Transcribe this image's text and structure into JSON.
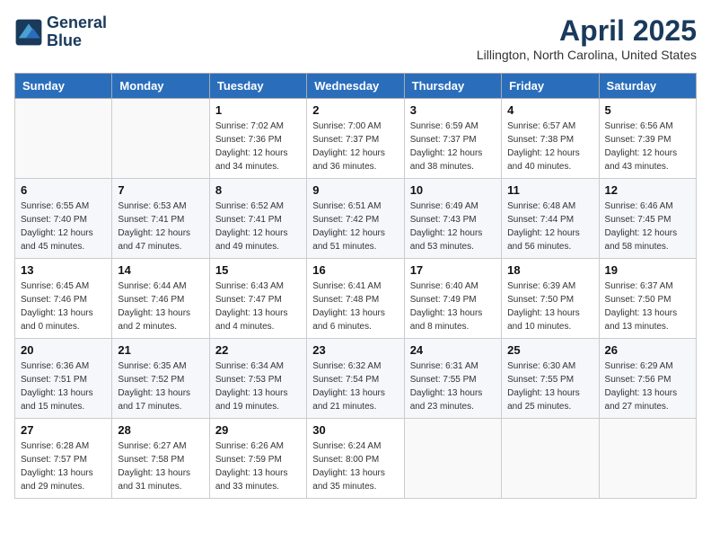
{
  "header": {
    "logo_line1": "General",
    "logo_line2": "Blue",
    "month": "April 2025",
    "location": "Lillington, North Carolina, United States"
  },
  "weekdays": [
    "Sunday",
    "Monday",
    "Tuesday",
    "Wednesday",
    "Thursday",
    "Friday",
    "Saturday"
  ],
  "weeks": [
    [
      {
        "day": "",
        "info": ""
      },
      {
        "day": "",
        "info": ""
      },
      {
        "day": "1",
        "info": "Sunrise: 7:02 AM\nSunset: 7:36 PM\nDaylight: 12 hours\nand 34 minutes."
      },
      {
        "day": "2",
        "info": "Sunrise: 7:00 AM\nSunset: 7:37 PM\nDaylight: 12 hours\nand 36 minutes."
      },
      {
        "day": "3",
        "info": "Sunrise: 6:59 AM\nSunset: 7:37 PM\nDaylight: 12 hours\nand 38 minutes."
      },
      {
        "day": "4",
        "info": "Sunrise: 6:57 AM\nSunset: 7:38 PM\nDaylight: 12 hours\nand 40 minutes."
      },
      {
        "day": "5",
        "info": "Sunrise: 6:56 AM\nSunset: 7:39 PM\nDaylight: 12 hours\nand 43 minutes."
      }
    ],
    [
      {
        "day": "6",
        "info": "Sunrise: 6:55 AM\nSunset: 7:40 PM\nDaylight: 12 hours\nand 45 minutes."
      },
      {
        "day": "7",
        "info": "Sunrise: 6:53 AM\nSunset: 7:41 PM\nDaylight: 12 hours\nand 47 minutes."
      },
      {
        "day": "8",
        "info": "Sunrise: 6:52 AM\nSunset: 7:41 PM\nDaylight: 12 hours\nand 49 minutes."
      },
      {
        "day": "9",
        "info": "Sunrise: 6:51 AM\nSunset: 7:42 PM\nDaylight: 12 hours\nand 51 minutes."
      },
      {
        "day": "10",
        "info": "Sunrise: 6:49 AM\nSunset: 7:43 PM\nDaylight: 12 hours\nand 53 minutes."
      },
      {
        "day": "11",
        "info": "Sunrise: 6:48 AM\nSunset: 7:44 PM\nDaylight: 12 hours\nand 56 minutes."
      },
      {
        "day": "12",
        "info": "Sunrise: 6:46 AM\nSunset: 7:45 PM\nDaylight: 12 hours\nand 58 minutes."
      }
    ],
    [
      {
        "day": "13",
        "info": "Sunrise: 6:45 AM\nSunset: 7:46 PM\nDaylight: 13 hours\nand 0 minutes."
      },
      {
        "day": "14",
        "info": "Sunrise: 6:44 AM\nSunset: 7:46 PM\nDaylight: 13 hours\nand 2 minutes."
      },
      {
        "day": "15",
        "info": "Sunrise: 6:43 AM\nSunset: 7:47 PM\nDaylight: 13 hours\nand 4 minutes."
      },
      {
        "day": "16",
        "info": "Sunrise: 6:41 AM\nSunset: 7:48 PM\nDaylight: 13 hours\nand 6 minutes."
      },
      {
        "day": "17",
        "info": "Sunrise: 6:40 AM\nSunset: 7:49 PM\nDaylight: 13 hours\nand 8 minutes."
      },
      {
        "day": "18",
        "info": "Sunrise: 6:39 AM\nSunset: 7:50 PM\nDaylight: 13 hours\nand 10 minutes."
      },
      {
        "day": "19",
        "info": "Sunrise: 6:37 AM\nSunset: 7:50 PM\nDaylight: 13 hours\nand 13 minutes."
      }
    ],
    [
      {
        "day": "20",
        "info": "Sunrise: 6:36 AM\nSunset: 7:51 PM\nDaylight: 13 hours\nand 15 minutes."
      },
      {
        "day": "21",
        "info": "Sunrise: 6:35 AM\nSunset: 7:52 PM\nDaylight: 13 hours\nand 17 minutes."
      },
      {
        "day": "22",
        "info": "Sunrise: 6:34 AM\nSunset: 7:53 PM\nDaylight: 13 hours\nand 19 minutes."
      },
      {
        "day": "23",
        "info": "Sunrise: 6:32 AM\nSunset: 7:54 PM\nDaylight: 13 hours\nand 21 minutes."
      },
      {
        "day": "24",
        "info": "Sunrise: 6:31 AM\nSunset: 7:55 PM\nDaylight: 13 hours\nand 23 minutes."
      },
      {
        "day": "25",
        "info": "Sunrise: 6:30 AM\nSunset: 7:55 PM\nDaylight: 13 hours\nand 25 minutes."
      },
      {
        "day": "26",
        "info": "Sunrise: 6:29 AM\nSunset: 7:56 PM\nDaylight: 13 hours\nand 27 minutes."
      }
    ],
    [
      {
        "day": "27",
        "info": "Sunrise: 6:28 AM\nSunset: 7:57 PM\nDaylight: 13 hours\nand 29 minutes."
      },
      {
        "day": "28",
        "info": "Sunrise: 6:27 AM\nSunset: 7:58 PM\nDaylight: 13 hours\nand 31 minutes."
      },
      {
        "day": "29",
        "info": "Sunrise: 6:26 AM\nSunset: 7:59 PM\nDaylight: 13 hours\nand 33 minutes."
      },
      {
        "day": "30",
        "info": "Sunrise: 6:24 AM\nSunset: 8:00 PM\nDaylight: 13 hours\nand 35 minutes."
      },
      {
        "day": "",
        "info": ""
      },
      {
        "day": "",
        "info": ""
      },
      {
        "day": "",
        "info": ""
      }
    ]
  ]
}
